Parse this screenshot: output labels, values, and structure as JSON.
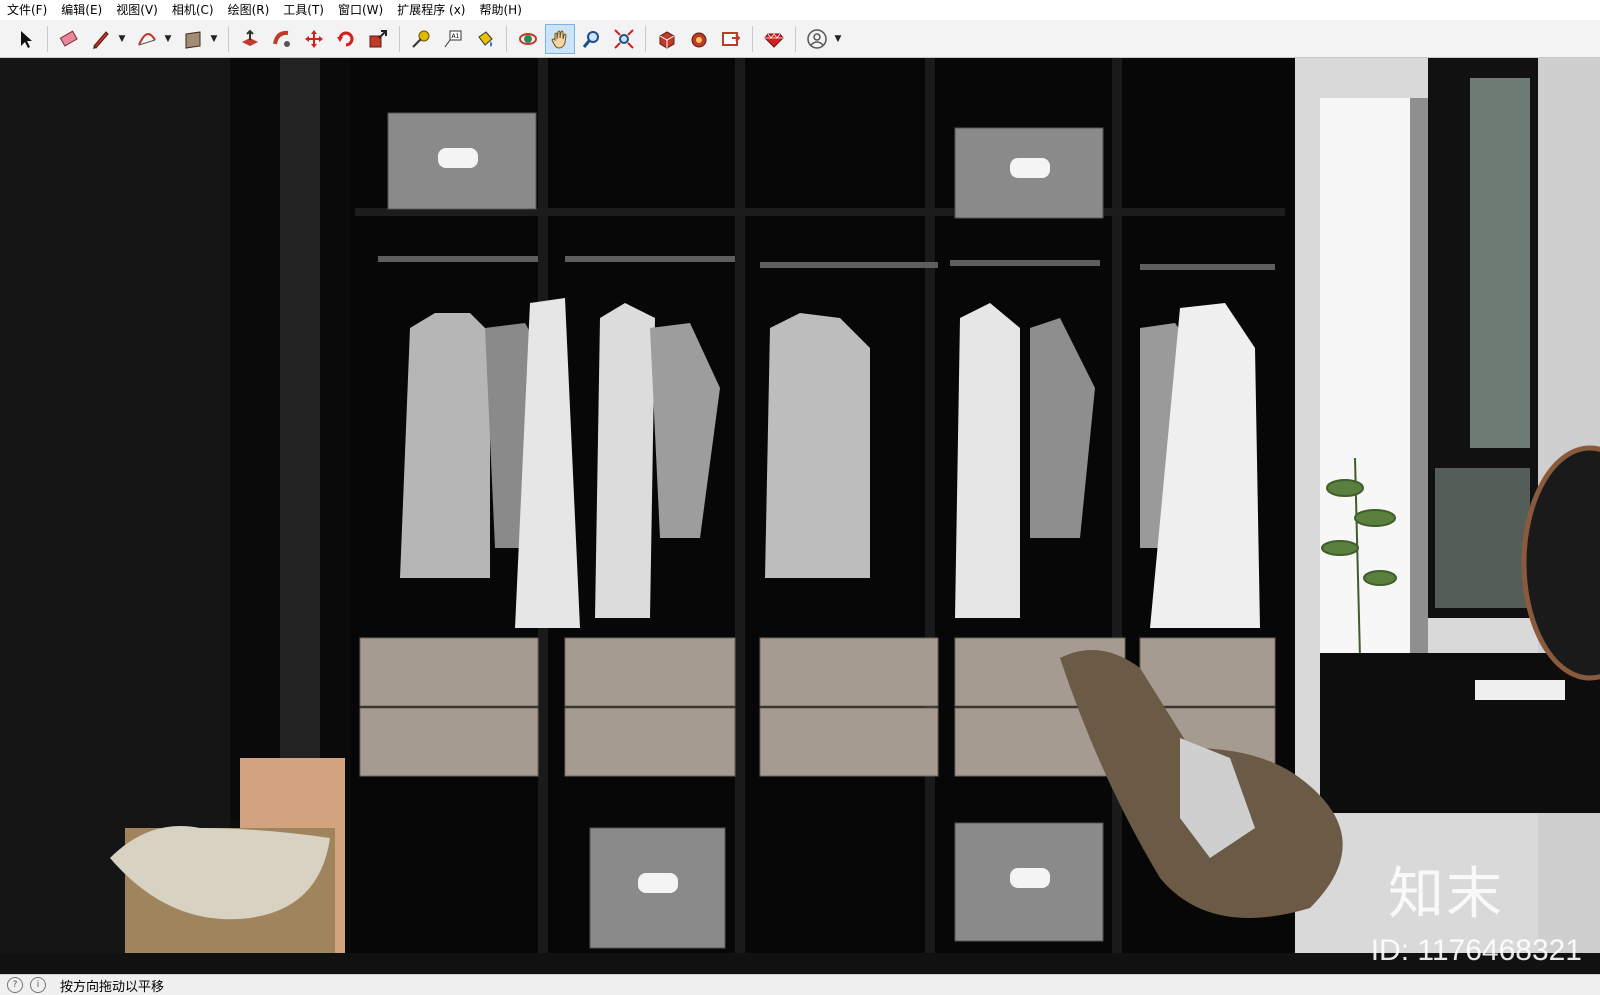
{
  "menu": [
    "文件(F)",
    "编辑(E)",
    "视图(V)",
    "相机(C)",
    "绘图(R)",
    "工具(T)",
    "窗口(W)",
    "扩展程序 (x)",
    "帮助(H)"
  ],
  "toolbar": {
    "select": "select-arrow-icon",
    "eraser": "eraser-icon",
    "pencil": "pencil-icon",
    "arc": "arc-icon",
    "rectangle": "rectangle-icon",
    "push_pull": "push-pull-icon",
    "follow_me": "follow-me-icon",
    "move": "move-icon",
    "rotate": "rotate-icon",
    "scale": "scale-icon",
    "tape": "tape-measure-icon",
    "text": "text-icon",
    "paint": "paint-bucket-icon",
    "orbit": "orbit-icon",
    "pan": "pan-hand-icon",
    "zoom": "zoom-icon",
    "zoom_extents": "zoom-extents-icon",
    "warehouse": "3d-warehouse-icon",
    "extension_warehouse": "extension-warehouse-icon",
    "layout": "send-to-layout-icon",
    "ruby": "ruby-console-icon",
    "account": "account-icon"
  },
  "active_tool": "pan",
  "status": {
    "message": "按方向拖动以平移"
  },
  "watermark": {
    "logo": "知末",
    "id": "ID: 1176468321"
  }
}
